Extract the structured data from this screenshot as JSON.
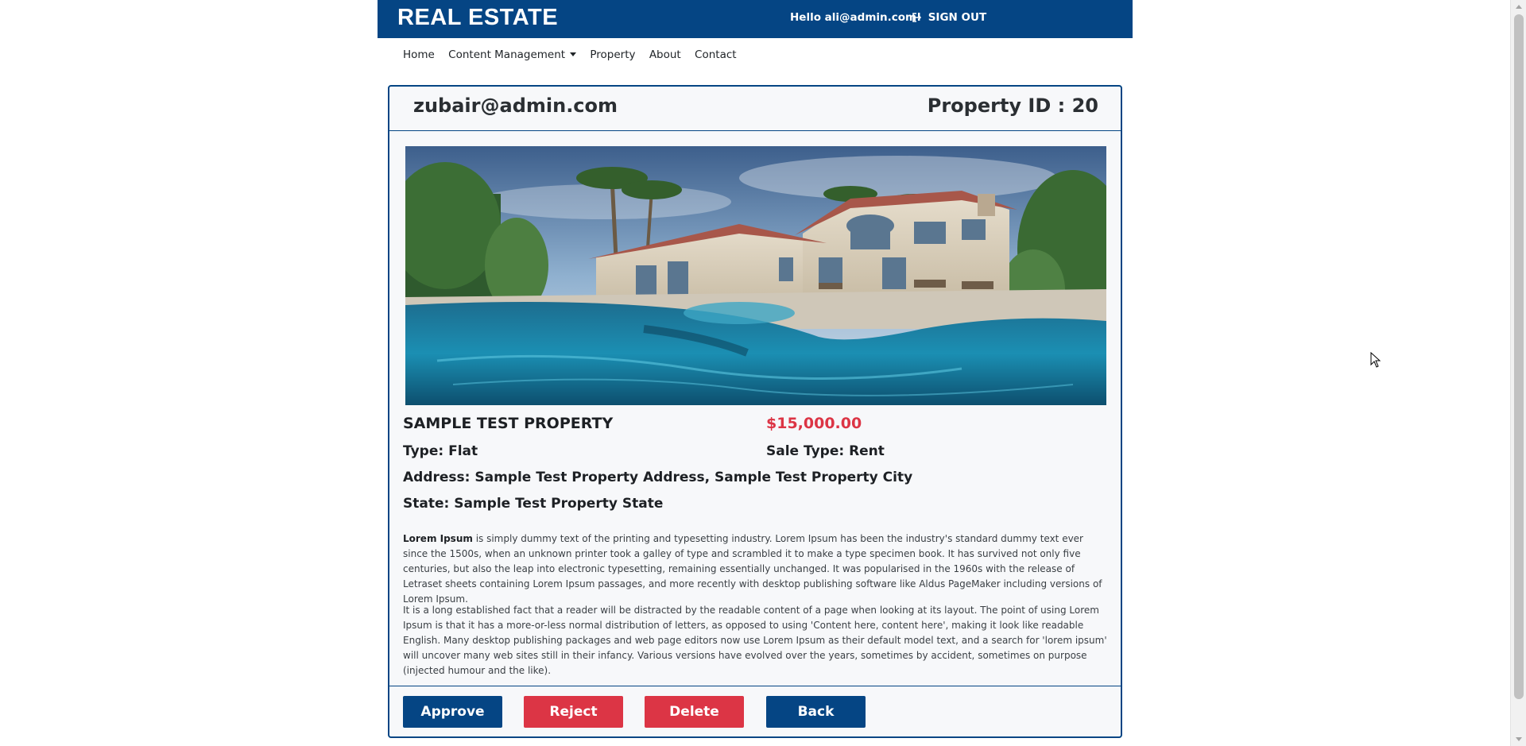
{
  "header": {
    "brand": "REAL ESTATE",
    "greeting": "Hello ali@admin.com!",
    "signout_label": "SIGN OUT",
    "background": "#054584"
  },
  "nav": {
    "items": [
      {
        "label": "Home"
      },
      {
        "label": "Content Management"
      },
      {
        "label": "Property"
      },
      {
        "label": "About"
      },
      {
        "label": "Contact"
      }
    ]
  },
  "property": {
    "owner_email": "zubair@admin.com",
    "id_label": "Property ID : 20",
    "title": "SAMPLE TEST PROPERTY",
    "price": "$15,000.00",
    "type": "Type: Flat",
    "sale_type": "Sale Type: Rent",
    "address": "Address: Sample Test Property Address, Sample Test Property City",
    "state": "State: Sample Test Property State",
    "description": {
      "p1_bold": "Lorem Ipsum",
      "p1_rest": " is simply dummy text of the printing and typesetting industry. Lorem Ipsum has been the industry's standard dummy text ever since the 1500s, when an unknown printer took a galley of type and scrambled it to make a type specimen book. It has survived not only five centuries, but also the leap into electronic typesetting, remaining essentially unchanged. It was popularised in the 1960s with the release of Letraset sheets containing Lorem Ipsum passages, and more recently with desktop publishing software like Aldus PageMaker including versions of Lorem Ipsum.",
      "p2": "It is a long established fact that a reader will be distracted by the readable content of a page when looking at its layout. The point of using Lorem Ipsum is that it has a more-or-less normal distribution of letters, as opposed to using 'Content here, content here', making it look like readable English. Many desktop publishing packages and web page editors now use Lorem Ipsum as their default model text, and a search for 'lorem ipsum' will uncover many web sites still in their infancy. Various versions have evolved over the years, sometimes by accident, sometimes on purpose (injected humour and the like)."
    }
  },
  "actions": {
    "approve": "Approve",
    "reject": "Reject",
    "delete": "Delete",
    "back": "Back"
  },
  "colors": {
    "primary": "#054584",
    "danger": "#dc3545"
  }
}
